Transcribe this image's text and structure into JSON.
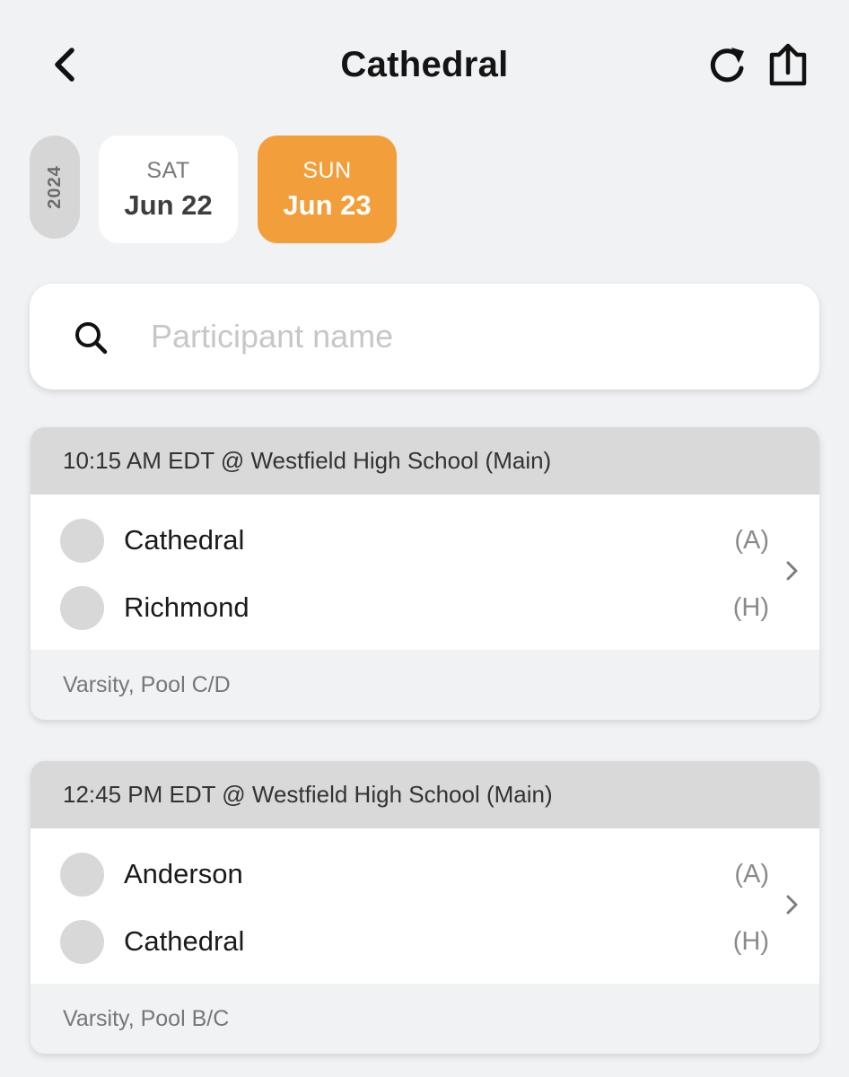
{
  "header": {
    "title": "Cathedral",
    "back_icon": "chevron-left-icon",
    "refresh_icon": "refresh-icon",
    "share_icon": "share-icon"
  },
  "date_picker": {
    "year": "2024",
    "dates": [
      {
        "dow": "SAT",
        "day": "Jun 22",
        "selected": false
      },
      {
        "dow": "SUN",
        "day": "Jun 23",
        "selected": true
      }
    ]
  },
  "search": {
    "placeholder": "Participant name",
    "value": ""
  },
  "matches": [
    {
      "header": "10:15 AM EDT @ Westfield High School (Main)",
      "teams": [
        {
          "name": "Cathedral",
          "side": "(A)"
        },
        {
          "name": "Richmond",
          "side": "(H)"
        }
      ],
      "footer": "Varsity, Pool C/D"
    },
    {
      "header": "12:45 PM EDT @ Westfield High School (Main)",
      "teams": [
        {
          "name": "Anderson",
          "side": "(A)"
        },
        {
          "name": "Cathedral",
          "side": "(H)"
        }
      ],
      "footer": "Varsity, Pool B/C"
    }
  ],
  "colors": {
    "accent": "#f29e3a",
    "background": "#f1f2f4",
    "card_header": "#d9d9d9"
  }
}
